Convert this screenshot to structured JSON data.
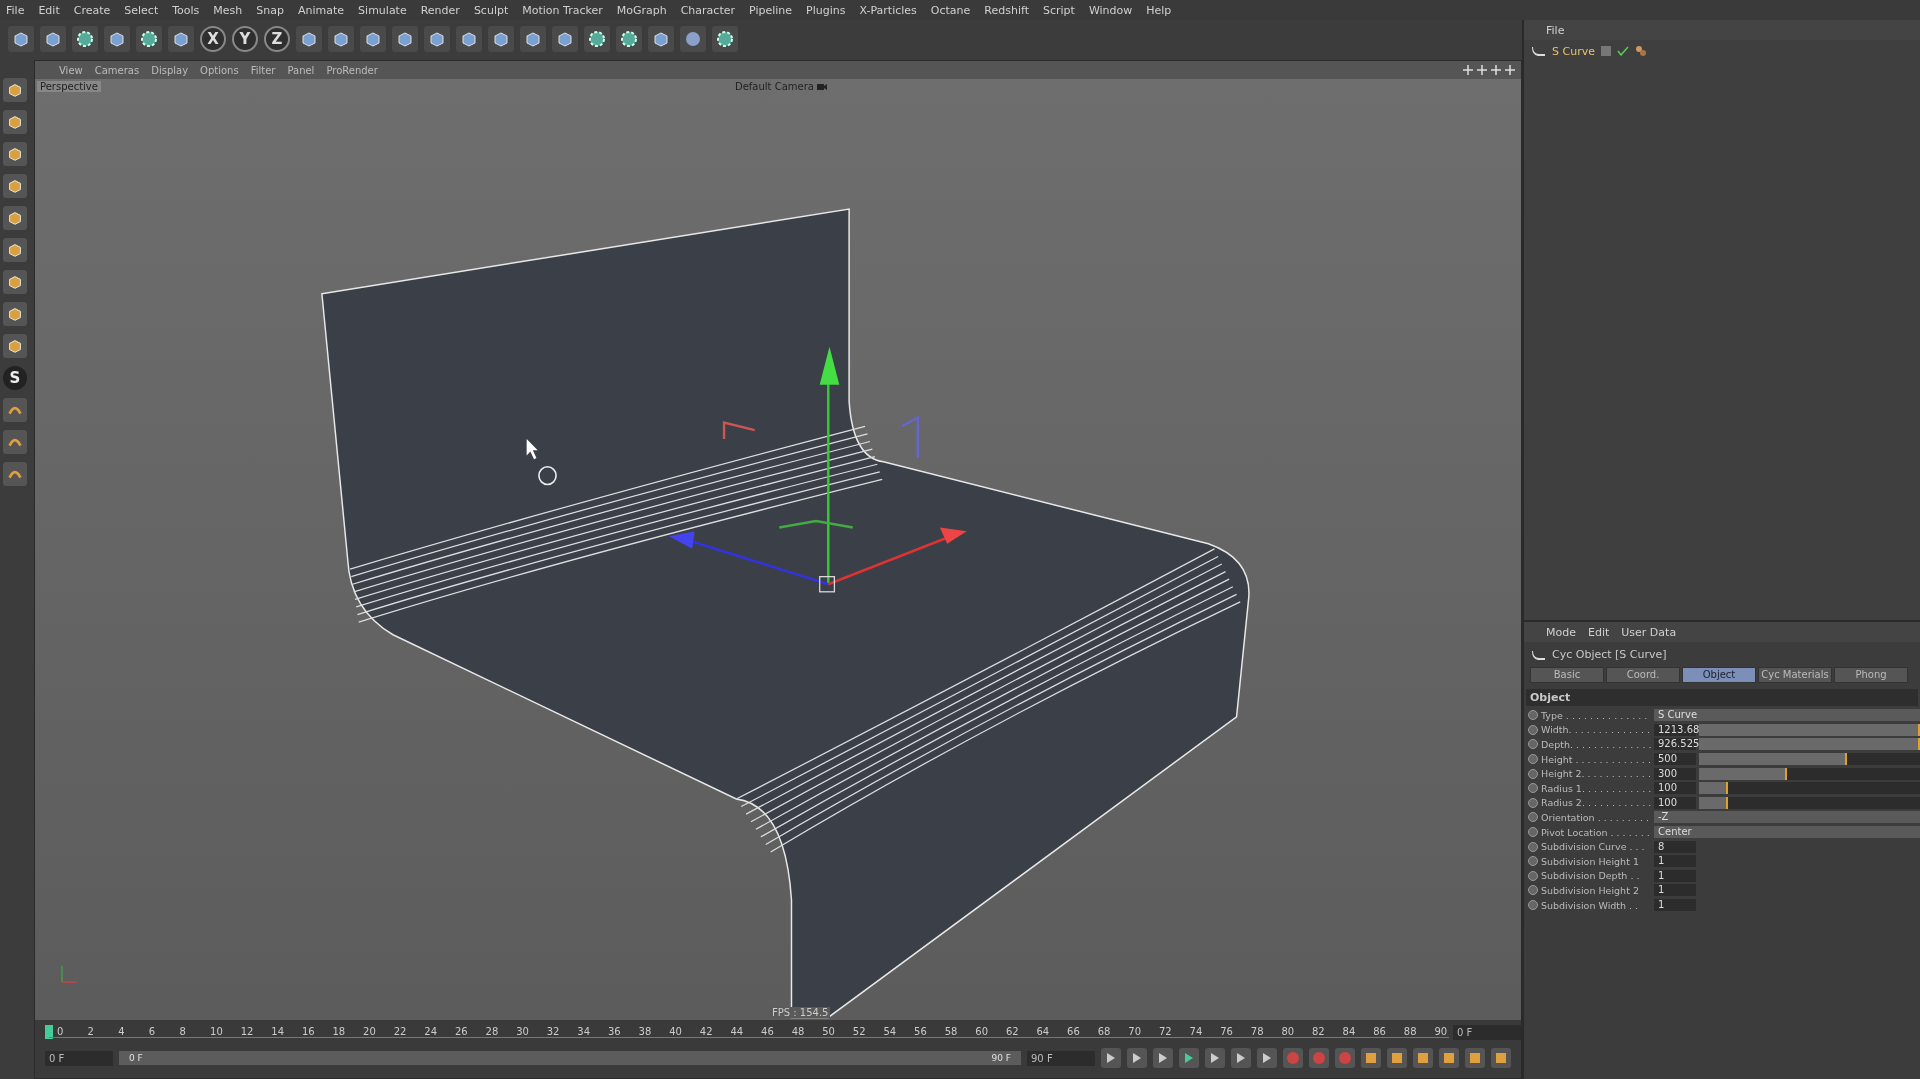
{
  "menu_bar": [
    "File",
    "Edit",
    "Create",
    "Select",
    "Tools",
    "Mesh",
    "Snap",
    "Animate",
    "Simulate",
    "Render",
    "Sculpt",
    "Motion Tracker",
    "MoGraph",
    "Character",
    "Pipeline",
    "Plugins",
    "X-Particles",
    "Octane",
    "Redshift",
    "Script",
    "Window",
    "Help"
  ],
  "axis_buttons": [
    {
      "label": "X"
    },
    {
      "label": "Y"
    },
    {
      "label": "Z"
    }
  ],
  "left_toolbar": {
    "s_tool": "S"
  },
  "viewport": {
    "menus": [
      "View",
      "Cameras",
      "Display",
      "Options",
      "Filter",
      "Panel",
      "ProRender"
    ],
    "view_name": "Perspective",
    "camera": "Default Camera",
    "fps": "FPS : 154.5"
  },
  "timeline": {
    "ticks": [
      "0",
      "2",
      "4",
      "6",
      "8",
      "10",
      "12",
      "14",
      "16",
      "18",
      "20",
      "22",
      "24",
      "26",
      "28",
      "30",
      "32",
      "34",
      "36",
      "38",
      "40",
      "42",
      "44",
      "46",
      "48",
      "50",
      "52",
      "54",
      "56",
      "58",
      "60",
      "62",
      "64",
      "66",
      "68",
      "70",
      "72",
      "74",
      "76",
      "78",
      "80",
      "82",
      "84",
      "86",
      "88",
      "90"
    ],
    "current_frame": "0 F",
    "start_field": "0 F",
    "range": {
      "start": "0 F",
      "end": "90 F",
      "level": 1
    },
    "end_field": "90 F"
  },
  "object_manager": {
    "menus": [
      "File"
    ],
    "objects": [
      {
        "name": "S Curve",
        "selected": true
      }
    ]
  },
  "attributes": {
    "menus": [
      "Mode",
      "Edit",
      "User Data"
    ],
    "title": "Cyc Object [S Curve]",
    "tabs": [
      {
        "label": "Basic",
        "selected": false
      },
      {
        "label": "Coord.",
        "selected": false
      },
      {
        "label": "Object",
        "selected": true
      },
      {
        "label": "Cyc Materials",
        "selected": false
      },
      {
        "label": "Phong",
        "selected": false
      }
    ],
    "section": "Object",
    "rows": [
      {
        "kind": "dropdown",
        "label": "Type . . . . . . . . . . . . . .",
        "value": "S Curve"
      },
      {
        "kind": "slider",
        "label": "Width. . . . . . . . . . . . . .",
        "value": "1213.68",
        "level": 1
      },
      {
        "kind": "slider",
        "label": "Depth. . . . . . . . . . . . . .",
        "value": "926.525",
        "level": 1
      },
      {
        "kind": "slider",
        "label": "Height . . . . . . . . . . . . .",
        "value": "500",
        "level": 0.67
      },
      {
        "kind": "slider",
        "label": "Height 2. . . . . . . . . . . .",
        "value": "300",
        "level": 0.4
      },
      {
        "kind": "slider",
        "label": "Radius 1. . . . . . . . . . . .",
        "value": "100",
        "level": 0.13
      },
      {
        "kind": "slider",
        "label": "Radius 2. . . . . . . . . . . .",
        "value": "100",
        "level": 0.13
      },
      {
        "kind": "dropdown",
        "label": "Orientation . . . . . . . . .",
        "value": "-Z"
      },
      {
        "kind": "dropdown",
        "label": "Pivot Location . . . . . . .",
        "value": "Center"
      },
      {
        "kind": "number",
        "label": "Subdivision Curve . . .",
        "value": "8"
      },
      {
        "kind": "number",
        "label": "Subdivision Height 1",
        "value": "1"
      },
      {
        "kind": "number",
        "label": "Subdivision Depth . .",
        "value": "1"
      },
      {
        "kind": "number",
        "label": "Subdivision Height 2",
        "value": "1"
      },
      {
        "kind": "number",
        "label": "Subdivision Width . .",
        "value": "1"
      }
    ]
  }
}
